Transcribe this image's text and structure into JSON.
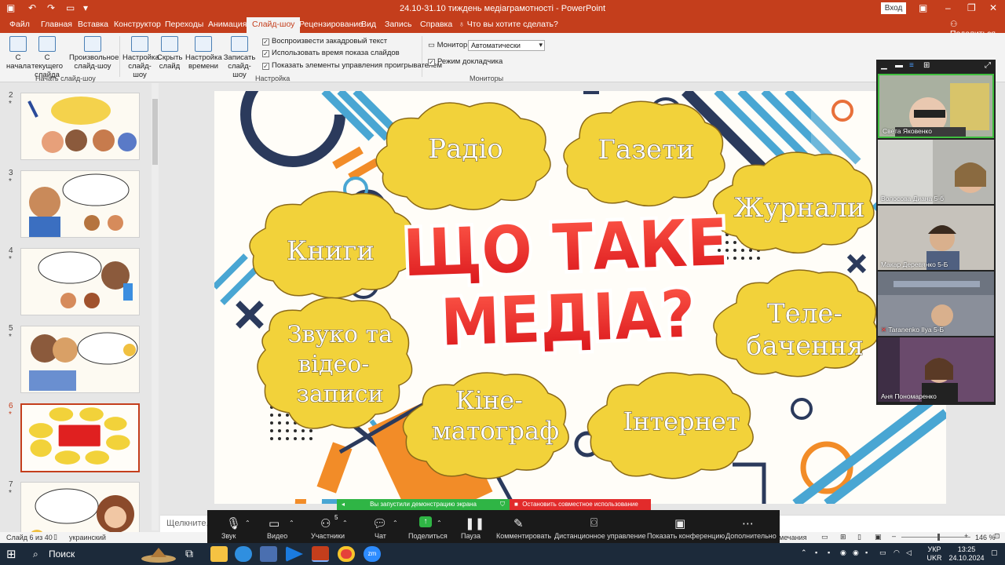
{
  "titlebar": {
    "title": "24.10-31.10 тиждень медіаграмотності  -  PowerPoint",
    "login_button": "Вход"
  },
  "tabs": [
    "Файл",
    "Главная",
    "Вставка",
    "Конструктор",
    "Переходы",
    "Анимация",
    "Слайд-шоу",
    "Рецензирование",
    "Вид",
    "Запись",
    "Справка"
  ],
  "active_tab": "Слайд-шоу",
  "tab_search": "Что вы хотите сделать?",
  "share_label": "Поделиться",
  "ribbon": {
    "from_start": "С начала",
    "from_current": "С текущего слайда",
    "custom_show": "Произвольное слайд-шоу",
    "group_start": "Начать слайд-шоу",
    "setup_show": "Настройка слайд-шоу",
    "hide_slide": "Скрыть слайд",
    "rehearse": "Настройка времени",
    "record": "Записать слайд-шоу",
    "group_setup": "Настройка",
    "chk_narration": "Воспроизвести закадровый текст",
    "chk_timings": "Использовать время показа слайдов",
    "chk_media_controls": "Показать элементы управления проигрывателем",
    "monitor_label": "Монитор:",
    "monitor_value": "Автоматически",
    "chk_presenter": "Режим докладчика",
    "group_monitors": "Мониторы"
  },
  "thumbnails": [
    {
      "num": "2",
      "star": "*"
    },
    {
      "num": "3",
      "star": "*"
    },
    {
      "num": "4",
      "star": "*"
    },
    {
      "num": "5",
      "star": "*"
    },
    {
      "num": "6",
      "star": "*"
    },
    {
      "num": "7",
      "star": "*"
    }
  ],
  "active_slide": "6",
  "slide": {
    "title_line1": "ЩО ТАКЕ",
    "title_line2": "МЕДІА?",
    "clouds": [
      "Радіо",
      "Газети",
      "Журнали",
      "Книги",
      "Звуко та",
      "відео-",
      "записи",
      "Теле-",
      "бачення",
      "Кіне-",
      "матограф",
      "Інтернет"
    ]
  },
  "notes_placeholder": "Щелкните, ч",
  "statusbar": {
    "slide_counter": "Слайд 6 из 40",
    "language": "украинский",
    "notes_label": "мечания",
    "zoom": "146 %"
  },
  "zoom_meeting": {
    "banner_sharing": "Вы запустили демонстрацию экрана",
    "banner_stop": "Остановить совместное использование",
    "participants_count": "5",
    "buttons": [
      "Звук",
      "Видео",
      "Участники",
      "Чат",
      "Поделиться",
      "Пауза",
      "Комментировать",
      "Дистанционное управление",
      "Показать конференцию",
      "Дополнительно"
    ],
    "participants": [
      "Света Яковенко",
      "Волосова Диана 5-б",
      "Макар Деревянко 5-Б",
      "Taranenko Ilya 5-Б",
      "Аня Пономаренко"
    ]
  },
  "taskbar": {
    "search": "Поиск",
    "lang": "УКР",
    "lang2": "UKR",
    "time": "13:25",
    "date": "24.10.2024"
  }
}
